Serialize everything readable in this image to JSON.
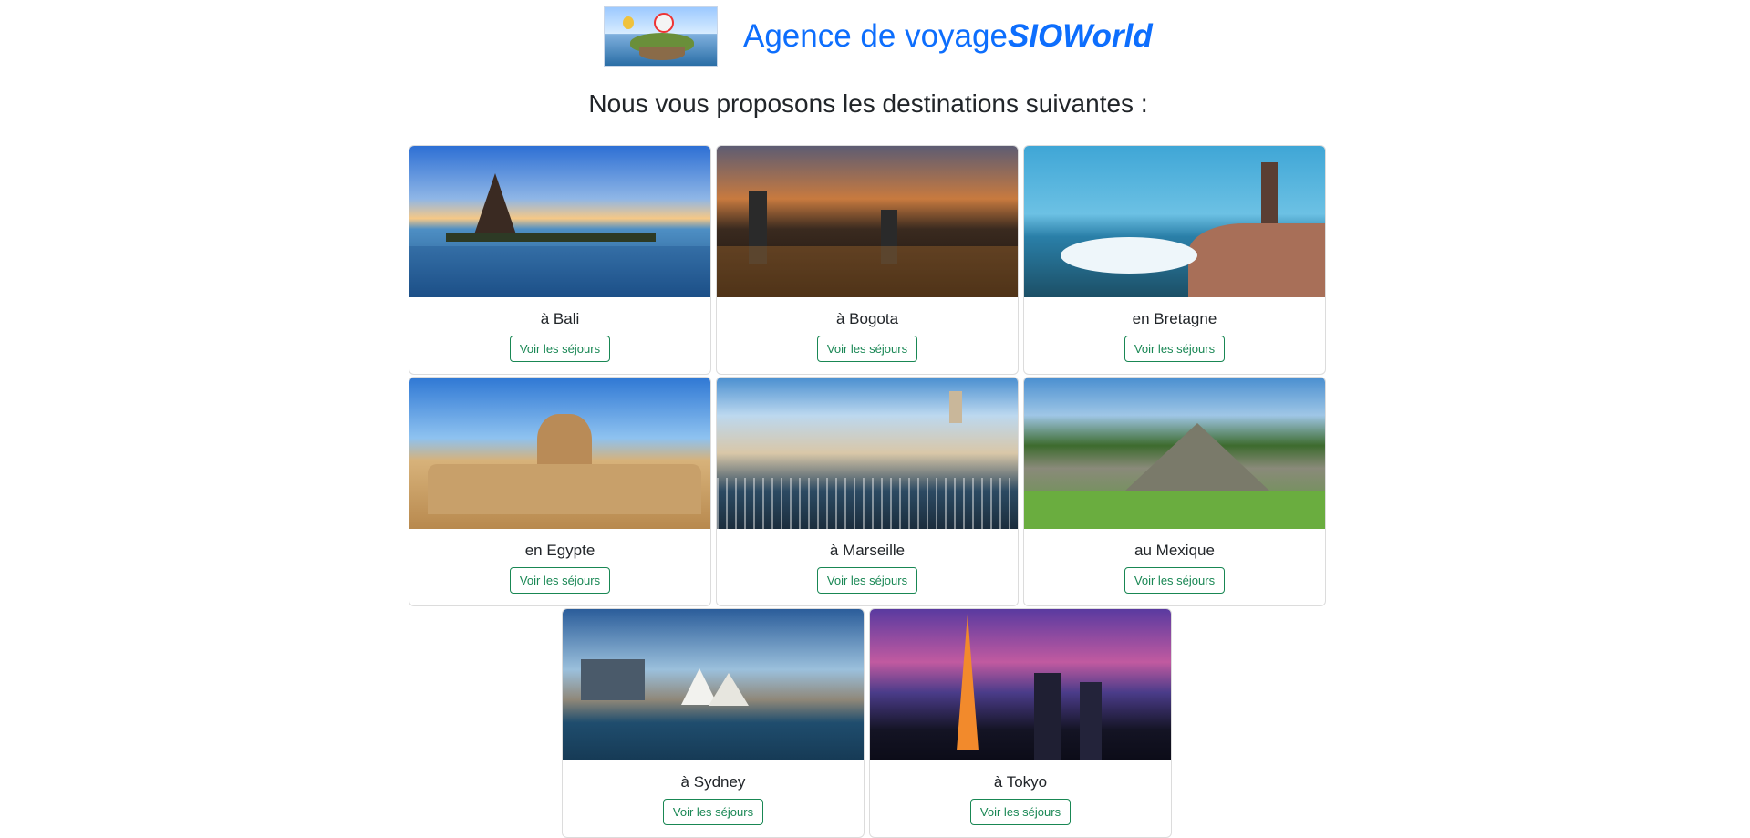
{
  "header": {
    "title_plain": "Agence de voyage",
    "title_brand": "SIOWorld"
  },
  "subtitle": "Nous vous proposons les destinations suivantes :",
  "colors": {
    "brand": "#0d6efd",
    "button": "#198754",
    "text": "#212529"
  },
  "destinations": [
    {
      "label": "à Bali",
      "button": "Voir les séjours"
    },
    {
      "label": "à Bogota",
      "button": "Voir les séjours"
    },
    {
      "label": "en Bretagne",
      "button": "Voir les séjours"
    },
    {
      "label": "en Egypte",
      "button": "Voir les séjours"
    },
    {
      "label": "à Marseille",
      "button": "Voir les séjours"
    },
    {
      "label": "au Mexique",
      "button": "Voir les séjours"
    },
    {
      "label": "à Sydney",
      "button": "Voir les séjours"
    },
    {
      "label": "à Tokyo",
      "button": "Voir les séjours"
    }
  ]
}
